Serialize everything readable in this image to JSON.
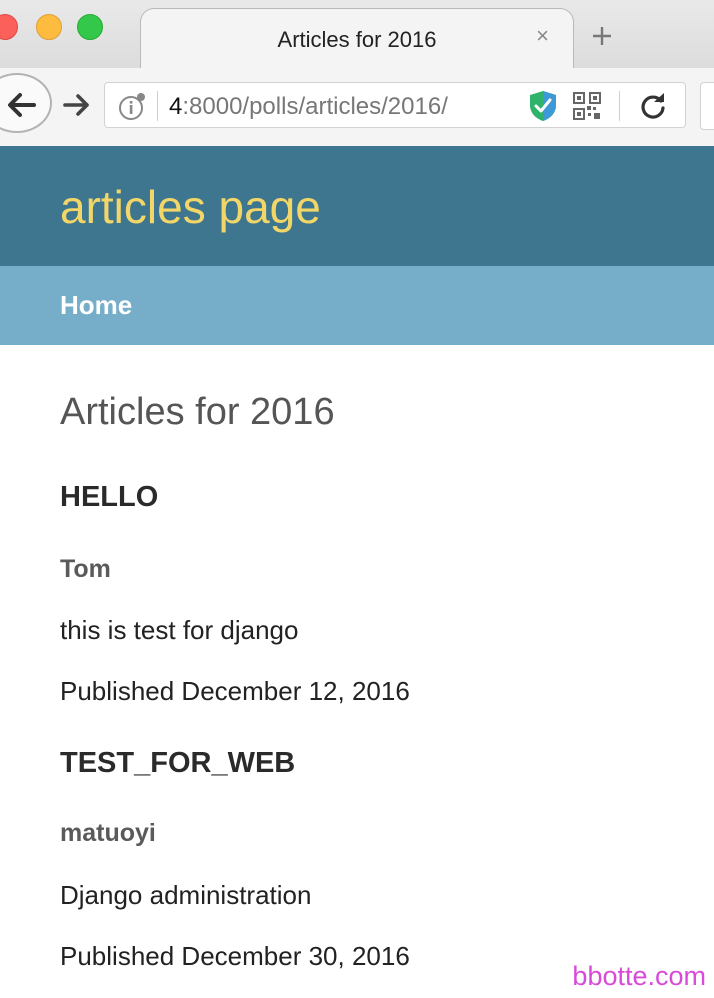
{
  "browser": {
    "tab_title": "Articles for 2016",
    "tab_close_glyph": "×",
    "url_host": "4",
    "url_path": ":8000/polls/articles/2016/"
  },
  "icons": {
    "back": "back-arrow-icon",
    "forward": "forward-arrow-icon",
    "info": "info-icon",
    "shield": "shield-check-icon",
    "qr": "qr-code-icon",
    "reload": "reload-icon",
    "new_tab": "plus-icon"
  },
  "colors": {
    "header_bg": "#3f768f",
    "site_title": "#f2d668",
    "nav_bg": "#76aeca",
    "watermark": "#d84ad8"
  },
  "site": {
    "title": "articles page",
    "nav": {
      "home_label": "Home"
    }
  },
  "main": {
    "heading": "Articles for 2016",
    "articles": [
      {
        "title": "HELLO",
        "author": "Tom",
        "body": "this is test for django",
        "published": "Published December 12, 2016"
      },
      {
        "title": "TEST_FOR_WEB",
        "author": "matuoyi",
        "body": "Django administration",
        "published": "Published December 30, 2016"
      }
    ]
  },
  "watermark": "bbotte.com"
}
